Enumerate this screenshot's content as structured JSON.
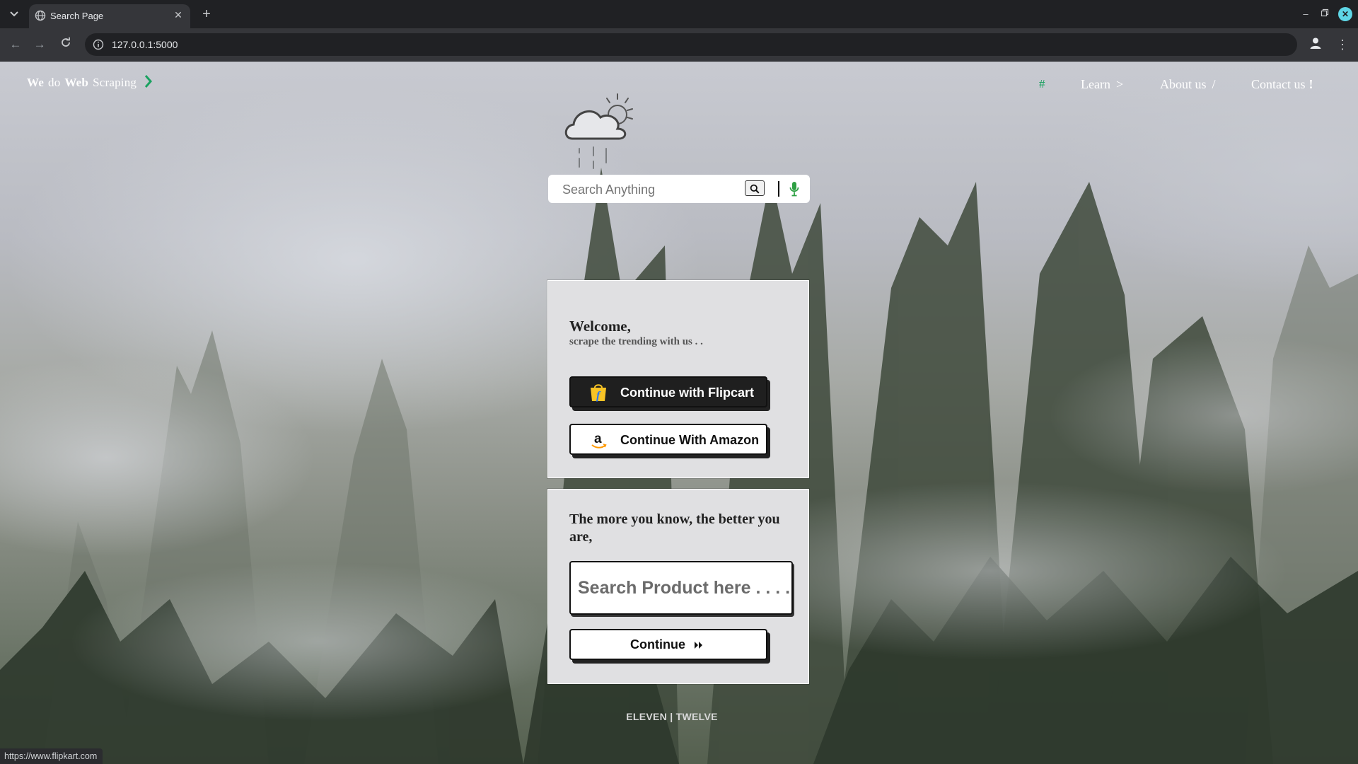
{
  "browser": {
    "tab_title": "Search Page",
    "url": "127.0.0.1:5000",
    "status_url": "https://www.flipkart.com"
  },
  "page": {
    "brand": {
      "w1": "We",
      "w2": "do",
      "w3": "Web",
      "w4": "Scraping"
    },
    "nav": {
      "hash": "#",
      "learn": "Learn",
      "learn_sep": ">",
      "about": "About us",
      "about_sep": "/",
      "contact": "Contact us",
      "contact_sep": "!"
    },
    "search": {
      "placeholder": "Search Anything"
    },
    "welcome": {
      "title": "Welcome,",
      "subtitle": "scrape the trending with us . .",
      "flipkart_label": "Continue with Flipcart",
      "amazon_label": "Continue With Amazon"
    },
    "product": {
      "quote": "The more you know, the better you are,",
      "placeholder": "Search Product here . . . .",
      "continue_label": "Continue"
    },
    "footer": "ELEVEN | TWELVE"
  },
  "colors": {
    "accent_green": "#1aa260",
    "flipkart_yellow": "#f7c325",
    "flipkart_blue": "#2874f0",
    "amazon_orange": "#ff9900"
  },
  "icons": [
    "tab-list-icon",
    "globe-icon",
    "close-icon",
    "plus-icon",
    "minimize-icon",
    "maximize-icon",
    "window-close-icon",
    "back-icon",
    "forward-icon",
    "reload-icon",
    "site-info-icon",
    "star-icon",
    "profile-icon",
    "menu-icon",
    "chevron-right-icon",
    "weather-icon",
    "search-icon",
    "mic-icon",
    "flipkart-icon",
    "amazon-icon",
    "double-chevron-icon"
  ]
}
